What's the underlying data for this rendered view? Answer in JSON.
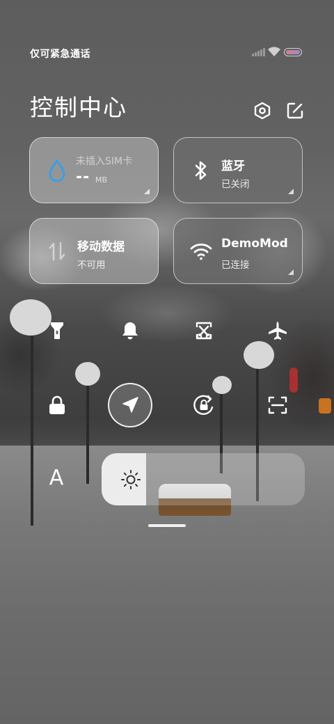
{
  "status_bar": {
    "carrier_text": "仅可紧急通话",
    "icons": [
      "signal-icon",
      "wifi-icon",
      "battery-icon"
    ]
  },
  "header": {
    "title": "控制中心",
    "icons": [
      "settings-icon",
      "edit-icon"
    ]
  },
  "tiles": [
    {
      "id": "mobile-data-usage",
      "title": "未插入SIM卡",
      "value": "--",
      "unit": "MB",
      "icon": "water-drop-icon",
      "accent": "#3a9fe6"
    },
    {
      "id": "bluetooth",
      "title": "蓝牙",
      "subtitle": "已关闭",
      "icon": "bluetooth-icon"
    },
    {
      "id": "mobile-data",
      "title": "移动数据",
      "subtitle": "不可用",
      "icon": "data-arrows-icon"
    },
    {
      "id": "wifi",
      "title": "DemoMod",
      "subtitle": "已连接",
      "icon": "wifi-icon"
    }
  ],
  "toggles_row1": [
    "flashlight-icon",
    "bell-icon",
    "screenshot-icon",
    "airplane-icon"
  ],
  "toggles_row2": [
    "lock-icon",
    "location-icon",
    "rotation-lock-icon",
    "scan-icon"
  ],
  "active_toggles": [
    "location-icon"
  ],
  "font_size_label": "A",
  "brightness": {
    "level": 0.22,
    "icon": "sun-icon"
  },
  "colors": {
    "accent_blue": "#3a9fe6",
    "brightness_fill": "#ececec"
  }
}
